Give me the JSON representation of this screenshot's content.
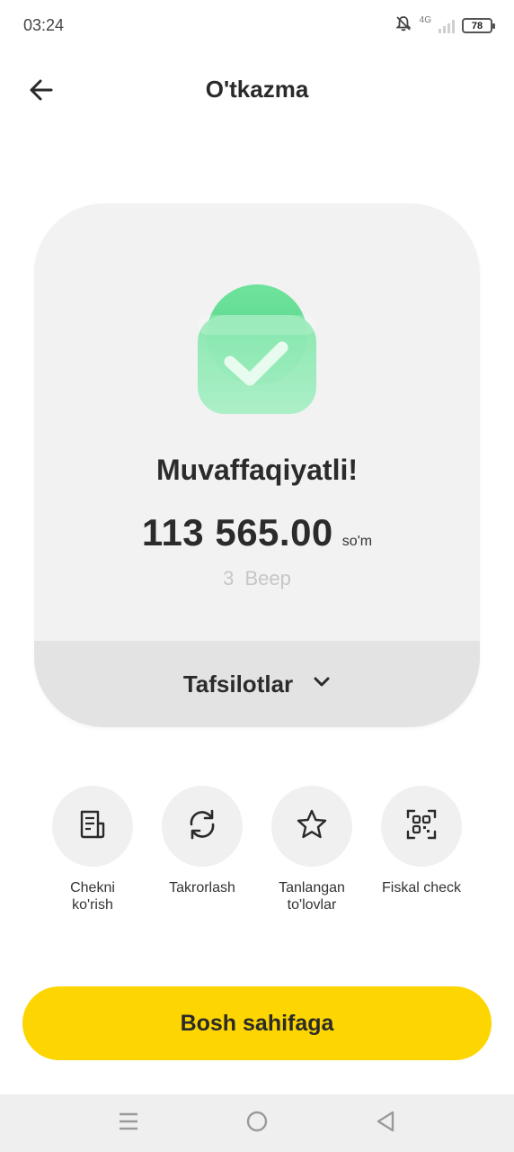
{
  "status_bar": {
    "time": "03:24",
    "network": "4G",
    "battery": "78"
  },
  "header": {
    "title": "O'tkazma",
    "back_icon": "arrow-left-icon"
  },
  "result": {
    "icon": "checkmark-shield-icon",
    "title": "Muvaffaqiyatli!",
    "amount": "113 565.00",
    "currency": "so'm",
    "recipient": "3 Beep",
    "details_label": "Tafsilotlar",
    "details_icon": "chevron-down-icon"
  },
  "actions": [
    {
      "line1": "Chekni",
      "line2": "ko'rish",
      "icon": "receipt-icon"
    },
    {
      "line1": "Takrorlash",
      "line2": "",
      "icon": "repeat-icon"
    },
    {
      "line1": "Tanlangan",
      "line2": "to'lovlar",
      "icon": "star-icon"
    },
    {
      "line1": "Fiskal check",
      "line2": "",
      "icon": "qr-code-icon"
    }
  ],
  "primary_button": {
    "label": "Bosh sahifaga"
  },
  "colors": {
    "accent": "#FDD500",
    "success": "#5EDB94",
    "card": "#F2F2F2",
    "details_bar": "#E3E3E3"
  }
}
